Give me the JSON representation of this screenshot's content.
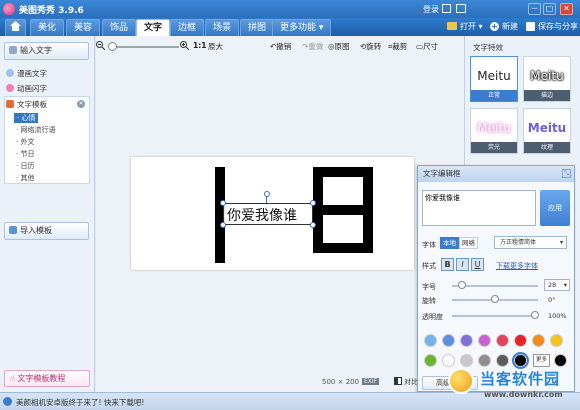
{
  "app": {
    "title": "美图秀秀 3.9.6"
  },
  "titlebar": {
    "login": "登录",
    "minimize": "－",
    "maximize": "□",
    "close": "✕"
  },
  "menu": {
    "tabs": [
      "美化",
      "美容",
      "饰品",
      "文字",
      "边框",
      "场景",
      "拼图",
      "更多功能 ▾"
    ],
    "active_tab": "文字",
    "open": "打开 ▾",
    "new": "新建",
    "save_share": "保存与分享"
  },
  "left": {
    "input_text": "输入文字",
    "manga_text": "漫画文字",
    "anim_text": "动画闪字",
    "templates": "文字模板",
    "sub_items": [
      "心情",
      "网络流行语",
      "外文",
      "节日",
      "日历",
      "其他"
    ],
    "selected_sub": "心情",
    "import_template": "导入模板",
    "tutorial": "文字模板教程"
  },
  "toolbar": {
    "ratio": "1:1",
    "original_size": "原大",
    "undo": "撤销",
    "redo": "重做",
    "original": "原图",
    "rotate": "旋转",
    "crop": "裁剪",
    "size": "尺寸"
  },
  "canvas": {
    "caption": "你爱我像谁",
    "dims_w": "500",
    "dims_x": "×",
    "dims_h": "200",
    "exif": "EXIF",
    "compare": "对比"
  },
  "effects": {
    "title": "文字特效",
    "items": [
      {
        "text": "Meitu",
        "label": "正常"
      },
      {
        "text": "Meitu",
        "label": "描边"
      },
      {
        "text": "Meitu",
        "label": "荧光"
      },
      {
        "text": "Meitu",
        "label": "纹理"
      }
    ]
  },
  "editor": {
    "title": "文字编辑框",
    "text_value": "你爱我像谁",
    "apply": "应用",
    "font_label": "字体",
    "font_local": "本地",
    "font_net": "网络",
    "font_name": "方正粗倩简体",
    "style_label": "样式",
    "bold": "B",
    "italic": "I",
    "underline": "U",
    "download_fonts": "下载更多字体",
    "size_label": "字号",
    "size_value": "28",
    "rotate_label": "旋转",
    "rotate_value": "0°",
    "opacity_label": "透明度",
    "opacity_value": "100%",
    "more_colors": "更多",
    "advanced": "高级设置",
    "colors_row1": [
      "#74b3ea",
      "#5b8fe0",
      "#7f72d6",
      "#c95fd1",
      "#e2445a",
      "#e6232a",
      "#f28a1c",
      "#f5c11b"
    ],
    "colors_row2": [
      "#68b52d",
      "#ffffff",
      "#c8c8c8",
      "#8e8e8e",
      "#5c5c5c",
      "#000000"
    ]
  },
  "status": {
    "message": "美颜相机安卓版终于来了! 快来下载吧!",
    "watermark_cn": "当客软件园",
    "watermark_url": "www.downkr.com"
  }
}
